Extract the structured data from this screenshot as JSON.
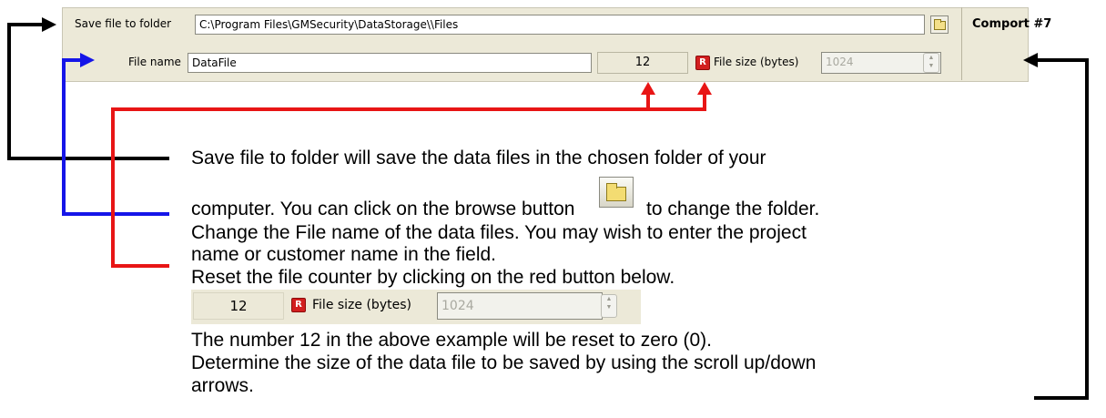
{
  "toolbar": {
    "save_folder_label": "Save file to folder",
    "save_folder_value": "C:\\Program Files\\GMSecurity\\DataStorage\\\\Files",
    "file_name_label": "File name",
    "file_name_value": "DataFile",
    "counter_value": "12",
    "reset_button_label": "R",
    "file_size_label": "File size (bytes)",
    "file_size_value": "1024",
    "comport_label": "Comport #7"
  },
  "explanation": {
    "line1": "Save file to folder will save the data files in the chosen folder of your",
    "line2a": "computer. You can click on the browse button",
    "line2b": "to change the folder.",
    "line3": "Change the File name of the data files. You may wish to enter the project",
    "line4": "name or customer name in the field.",
    "line5": "Reset the file counter by clicking on the red button below.",
    "line6": "The number 12 in the above example will be reset to zero (0).",
    "line7": "Determine the size of the data file to be saved by using the scroll up/down",
    "line8": "arrows."
  },
  "example": {
    "counter_value": "12",
    "reset_button_label": "R",
    "file_size_label": "File size (bytes)",
    "file_size_value": "1024"
  },
  "colors": {
    "folder_arrow": "#000000",
    "filename_arrow": "#1515e8",
    "reset_arrow": "#e81515",
    "filesize_arrow": "#000000"
  },
  "icons": [
    "folder-icon",
    "reset-icon",
    "spin-up-icon",
    "spin-down-icon",
    "arrow-right-icon",
    "arrow-left-icon",
    "arrow-up-icon"
  ]
}
